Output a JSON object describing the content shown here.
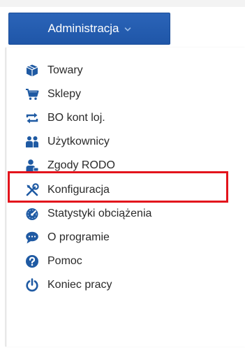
{
  "header": {
    "menu_button_label": "Administracja"
  },
  "menu": {
    "items": [
      {
        "label": "Towary",
        "icon": "package-icon"
      },
      {
        "label": "Sklepy",
        "icon": "cart-icon"
      },
      {
        "label": "BO kont loj.",
        "icon": "sync-icon"
      },
      {
        "label": "Użytkownicy",
        "icon": "users-icon"
      },
      {
        "label": "Zgody RODO",
        "icon": "user-consent-icon"
      },
      {
        "label": "Konfiguracja",
        "icon": "tools-icon"
      },
      {
        "label": "Statystyki obciążenia",
        "icon": "dashboard-icon"
      },
      {
        "label": "O programie",
        "icon": "comment-icon"
      },
      {
        "label": "Pomoc",
        "icon": "help-icon"
      },
      {
        "label": "Koniec pracy",
        "icon": "power-icon"
      }
    ]
  },
  "colors": {
    "button_bg": "#2160b0",
    "icon_blue": "#1f5aa3",
    "highlight": "#e3141c"
  }
}
